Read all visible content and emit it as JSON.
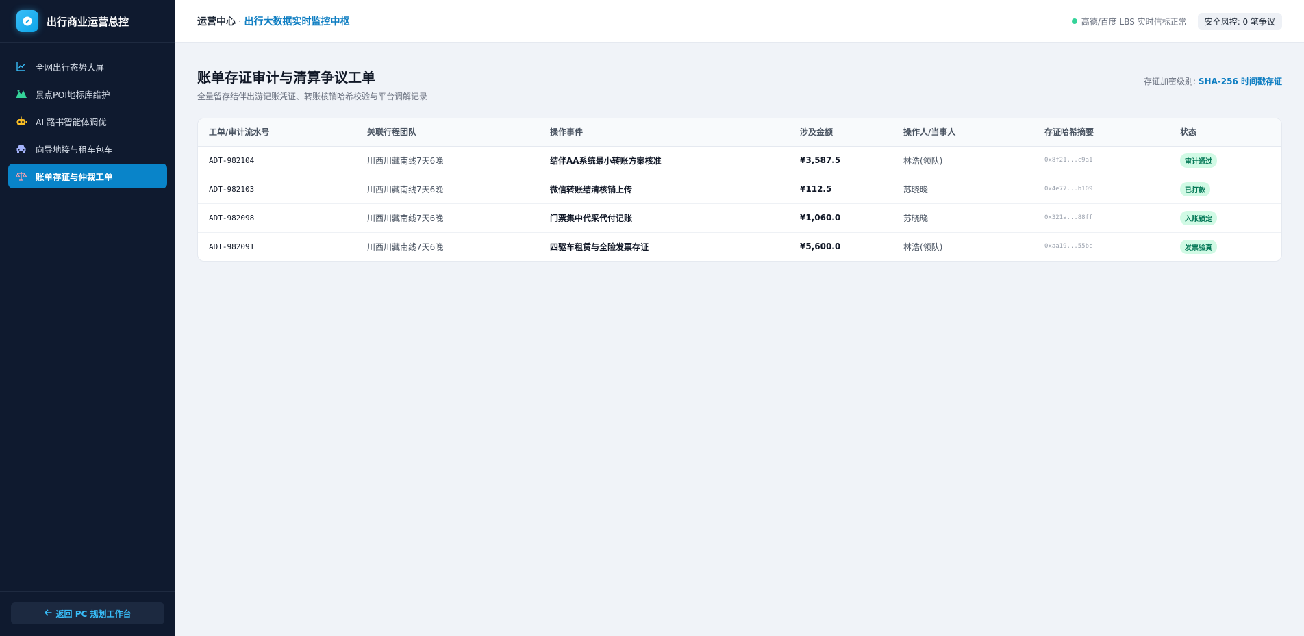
{
  "brand": {
    "title": "出行商业运营总控"
  },
  "sidebar": {
    "items": [
      {
        "label": "全网出行态势大屏",
        "icon": "line-chart-icon",
        "color": "#38bdf8"
      },
      {
        "label": "景点POI地标库维护",
        "icon": "mountain-icon",
        "color": "#34d399"
      },
      {
        "label": "AI 路书智能体调优",
        "icon": "robot-icon",
        "color": "#fbbf24"
      },
      {
        "label": "向导地接与租车包车",
        "icon": "car-icon",
        "color": "#a5b4fc"
      },
      {
        "label": "账单存证与仲裁工单",
        "icon": "scale-icon",
        "color": "#fda4af",
        "active": true
      }
    ],
    "footer_button": "返回 PC 规划工作台"
  },
  "header": {
    "crumb_root": "运营中心",
    "crumb_sep": "·",
    "crumb_current": "出行大数据实时监控中枢",
    "status_text": "高德/百度 LBS 实时信标正常",
    "risk_text": "安全风控: 0 笔争议"
  },
  "page": {
    "title": "账单存证审计与清算争议工单",
    "subtitle": "全量留存结伴出游记账凭证、转账核销哈希校验与平台调解记录",
    "level_label": "存证加密级别: ",
    "level_value": "SHA-256 时间戳存证"
  },
  "table": {
    "columns": [
      "工单/审计流水号",
      "关联行程团队",
      "操作事件",
      "涉及金额",
      "操作人/当事人",
      "存证哈希摘要",
      "状态"
    ],
    "rows": [
      {
        "id": "ADT-982104",
        "team": "川西川藏南线7天6晚",
        "event": "结伴AA系统最小转账方案核准",
        "amount": "¥3,587.5",
        "person": "林浩(领队)",
        "hash": "0x8f21...c9a1",
        "status": "审计通过"
      },
      {
        "id": "ADT-982103",
        "team": "川西川藏南线7天6晚",
        "event": "微信转账结清核销上传",
        "amount": "¥112.5",
        "person": "苏晓晓",
        "hash": "0x4e77...b109",
        "status": "已打款"
      },
      {
        "id": "ADT-982098",
        "team": "川西川藏南线7天6晚",
        "event": "门票集中代采代付记账",
        "amount": "¥1,060.0",
        "person": "苏晓晓",
        "hash": "0x321a...88ff",
        "status": "入账锁定"
      },
      {
        "id": "ADT-982091",
        "team": "川西川藏南线7天6晚",
        "event": "四驱车租赁与全险发票存证",
        "amount": "¥5,600.0",
        "person": "林浩(领队)",
        "hash": "0xaa19...55bc",
        "status": "发票验真"
      }
    ]
  }
}
